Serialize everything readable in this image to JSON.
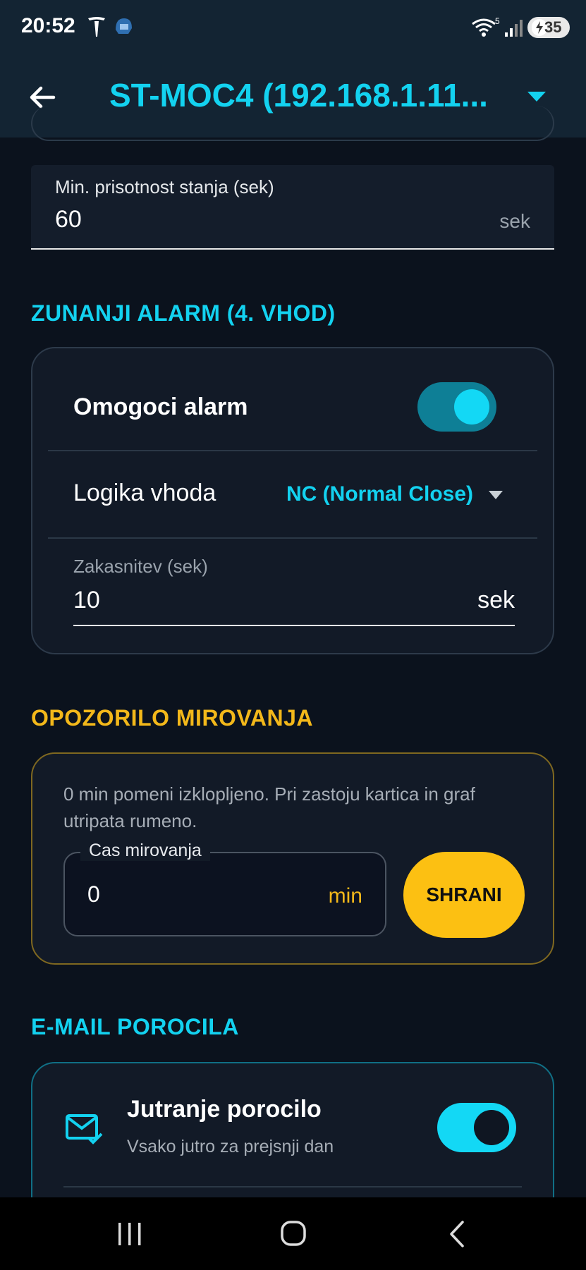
{
  "status_bar": {
    "time": "20:52",
    "wifi_badge": "5",
    "battery_pct": "35",
    "icons": [
      "tesla-icon",
      "helmet-icon",
      "wifi-icon",
      "signal-icon",
      "battery-icon"
    ]
  },
  "app_bar": {
    "title": "ST-MOC4 (192.168.1.11...",
    "back_icon": "arrow-left-icon",
    "dropdown_icon": "caret-down-icon"
  },
  "min_presence_field": {
    "label": "Min. prisotnost stanja (sek)",
    "value": "60",
    "suffix": "sek"
  },
  "external_alarm": {
    "section_title": "ZUNANJI ALARM (4. VHOD)",
    "enable_label": "Omogoci alarm",
    "enable_on": true,
    "logic_label": "Logika vhoda",
    "logic_value": "NC (Normal Close)",
    "delay_label": "Zakasnitev (sek)",
    "delay_value": "10",
    "delay_suffix": "sek"
  },
  "idle_warning": {
    "section_title": "OPOZORILO MIROVANJA",
    "helper_line1": "0 min pomeni izklopljeno. Pri zastoju kartica in graf",
    "helper_line2": "utripata rumeno.",
    "field_label": "Cas mirovanja",
    "field_value": "0",
    "field_suffix": "min",
    "save_label": "SHRANI"
  },
  "email_reports": {
    "section_title": "E-MAIL POROCILA",
    "morning_title": "Jutranje porocilo",
    "morning_subtitle": "Vsako jutro za prejsnji dan",
    "morning_on": true,
    "icon": "mail-check-icon"
  },
  "colors": {
    "cyan": "#13d2f0",
    "amber": "#f3b81a",
    "background": "#0b121d",
    "card": "#121a27"
  }
}
